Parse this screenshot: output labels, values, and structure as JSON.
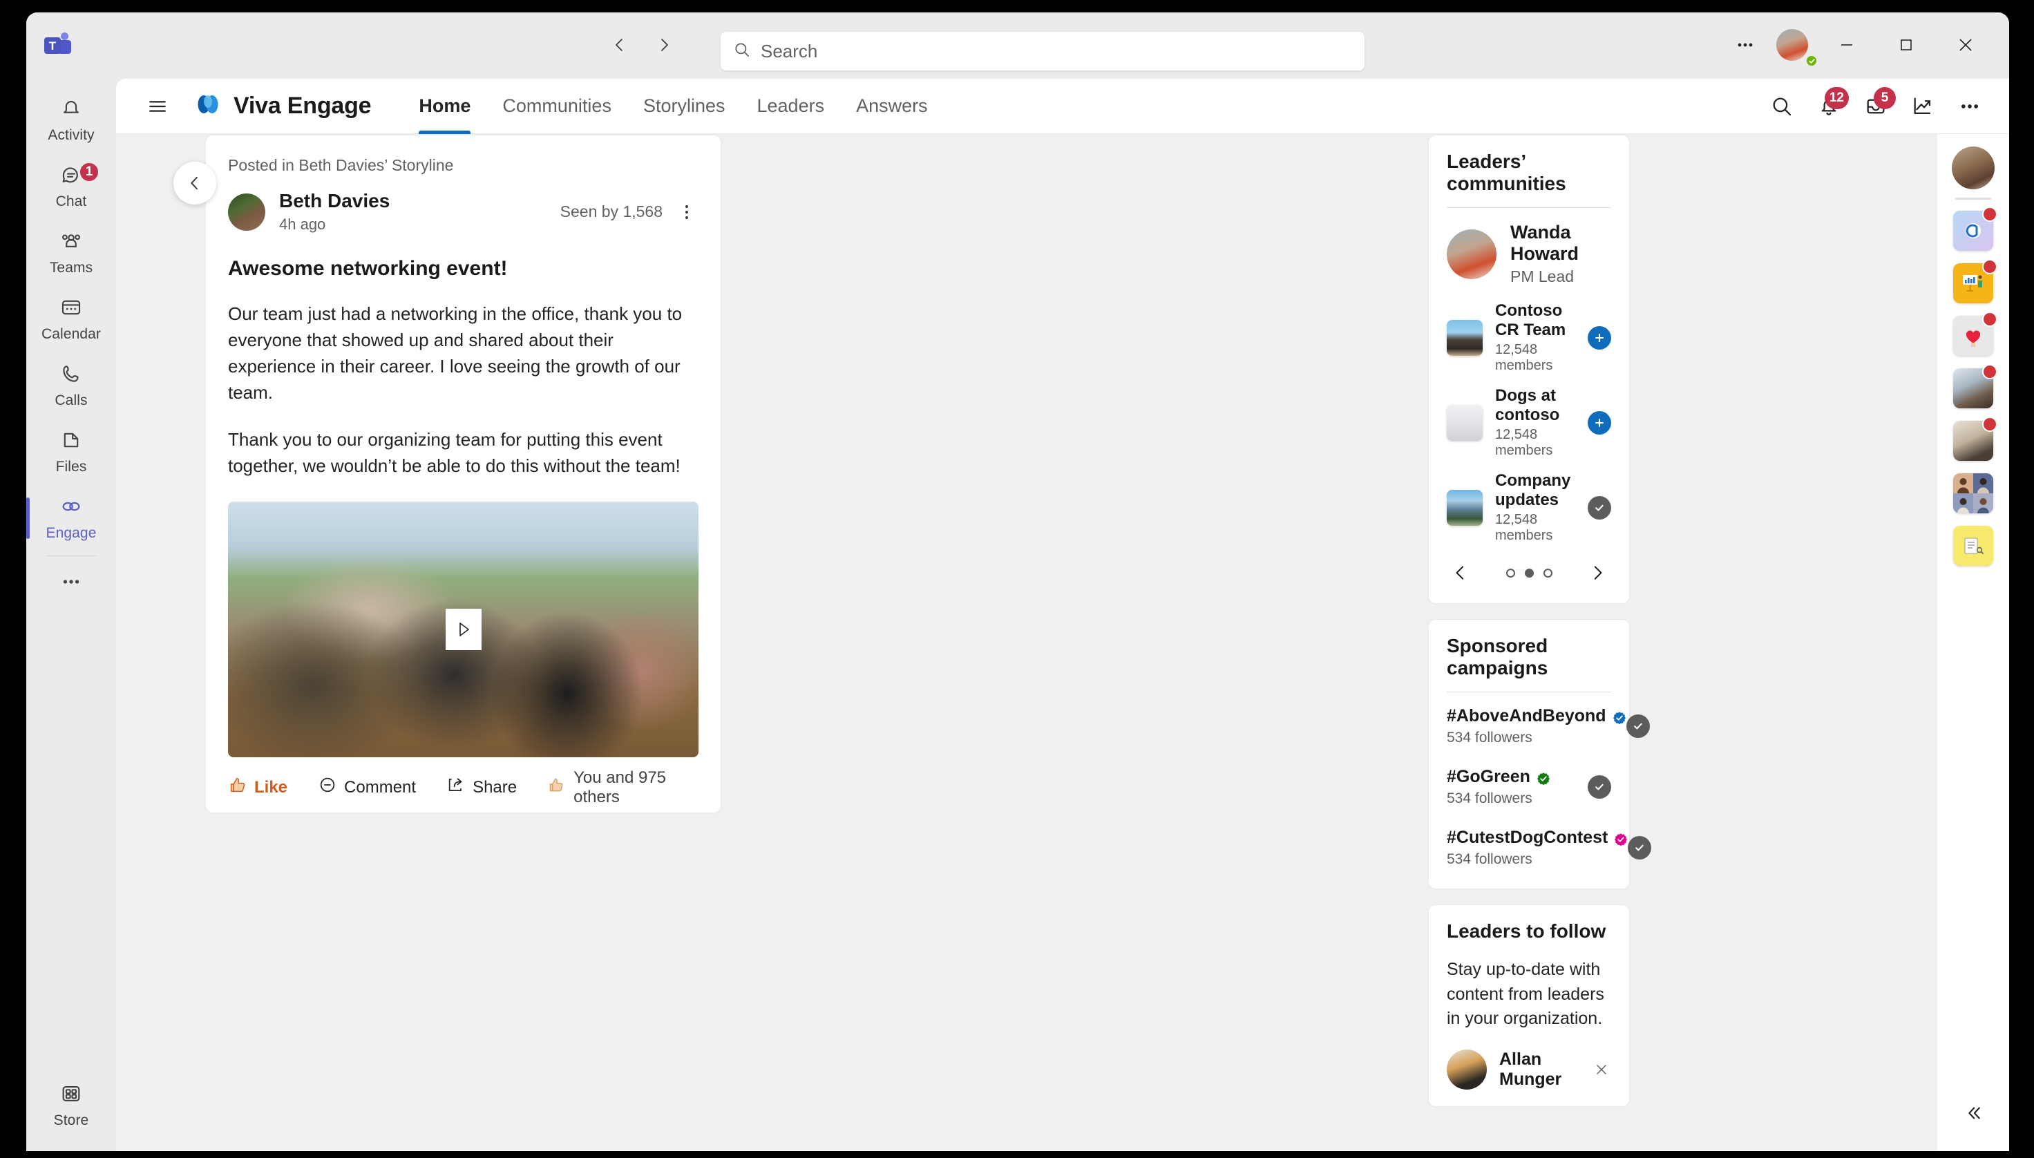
{
  "titlebar": {
    "app_logo": "teams-logo",
    "back_label": "Back",
    "forward_label": "Forward",
    "search": {
      "placeholder": "Search",
      "value": ""
    },
    "more_label": "Settings and more",
    "presence": "Available",
    "minimize_label": "Minimize",
    "maximize_label": "Maximize",
    "close_label": "Close"
  },
  "app_rail": {
    "items": [
      {
        "label": "Activity",
        "icon": "activity-bell-icon",
        "badge": ""
      },
      {
        "label": "Chat",
        "icon": "chat-icon",
        "badge": "1"
      },
      {
        "label": "Teams",
        "icon": "teams-people-icon",
        "badge": ""
      },
      {
        "label": "Calendar",
        "icon": "calendar-icon",
        "badge": ""
      },
      {
        "label": "Calls",
        "icon": "calls-phone-icon",
        "badge": ""
      },
      {
        "label": "Files",
        "icon": "files-icon",
        "badge": ""
      },
      {
        "label": "Engage",
        "icon": "engage-icon",
        "badge": "",
        "active": true
      }
    ],
    "more_label": "More apps",
    "store": {
      "label": "Store",
      "icon": "store-icon"
    }
  },
  "viva_header": {
    "menu_label": "Menu",
    "brand": "Viva Engage",
    "tabs": [
      {
        "label": "Home",
        "active": true
      },
      {
        "label": "Communities",
        "active": false
      },
      {
        "label": "Storylines",
        "active": false
      },
      {
        "label": "Leaders",
        "active": false
      },
      {
        "label": "Answers",
        "active": false
      }
    ],
    "actions": [
      {
        "name": "search-icon",
        "badge": ""
      },
      {
        "name": "notifications-bell-icon",
        "badge": "12"
      },
      {
        "name": "inbox-icon",
        "badge": "5"
      },
      {
        "name": "analytics-trend-icon",
        "badge": ""
      },
      {
        "name": "more-options-icon",
        "badge": ""
      }
    ]
  },
  "post": {
    "back_label": "Back",
    "posted_in": "Posted in Beth Davies’ Storyline",
    "author": "Beth Davies",
    "time": "4h ago",
    "seen_by": "Seen by 1,568",
    "more_label": "More options",
    "title": "Awesome networking event!",
    "paragraph1": "Our team just had a networking in the office, thank you to everyone that showed up and shared about their experience in their career. I love seeing the growth of our team.",
    "paragraph2": "Thank you to our organizing team for putting this event together, we wouldn’t be able to do this without the team!",
    "play_label": "Play video",
    "actions": {
      "like": "Like",
      "comment": "Comment",
      "share": "Share",
      "reactions_summary": "You and 975 others"
    }
  },
  "leaders_communities": {
    "title": "Leaders’ communities",
    "leader": {
      "name": "Wanda Howard",
      "role": "PM Lead",
      "photo": "ph-wanda"
    },
    "communities": [
      {
        "name": "Contoso CR Team",
        "members": "12,548 members",
        "action": "add",
        "thumb": "ph-rock"
      },
      {
        "name": "Dogs at contoso",
        "members": "12,548 members",
        "action": "add",
        "thumb": "ph-dog"
      },
      {
        "name": "Company updates",
        "members": "12,548 members",
        "action": "done",
        "thumb": "ph-bldg"
      }
    ],
    "carousel": {
      "prev": "Previous",
      "next": "Next",
      "dots": 3,
      "active_dot": 1
    }
  },
  "sponsored_campaigns": {
    "title": "Sponsored campaigns",
    "items": [
      {
        "name": "#AboveAndBeyond",
        "followers": "534 followers",
        "badge_color": "#0f6cbd",
        "action": "done"
      },
      {
        "name": "#GoGreen",
        "followers": "534 followers",
        "badge_color": "#107c10",
        "action": "done"
      },
      {
        "name": "#CutestDogContest",
        "followers": "534 followers",
        "badge_color": "#e3008c",
        "action": "done"
      }
    ]
  },
  "leaders_to_follow": {
    "title": "Leaders to follow",
    "description": "Stay up-to-date with content from leaders in your organization.",
    "first_leader": "Allan Munger",
    "close_label": "Dismiss"
  },
  "far_rail": {
    "avatar_label": "Your profile",
    "apps": [
      {
        "name": "app-copilot-icon",
        "badge": true,
        "style": "copilot"
      },
      {
        "name": "app-presentation-icon",
        "badge": true,
        "style": "present"
      },
      {
        "name": "app-praise-heart-icon",
        "badge": true,
        "style": "heart"
      },
      {
        "name": "app-person-chat-icon",
        "badge": true,
        "style": "ph-fr2"
      },
      {
        "name": "app-meeting-icon",
        "badge": true,
        "style": "ph-fr3"
      },
      {
        "name": "app-people-grid-icon",
        "badge": false,
        "style": "grid"
      },
      {
        "name": "app-notes-icon",
        "badge": false,
        "style": "notes"
      }
    ],
    "collapse_label": "Collapse pane"
  },
  "colors": {
    "accent": "#5b5fc7",
    "tab_underline": "#0f6cbd",
    "badge_red": "#c4314b",
    "presence_green": "#6bb700",
    "like_orange": "#d15c1e"
  }
}
